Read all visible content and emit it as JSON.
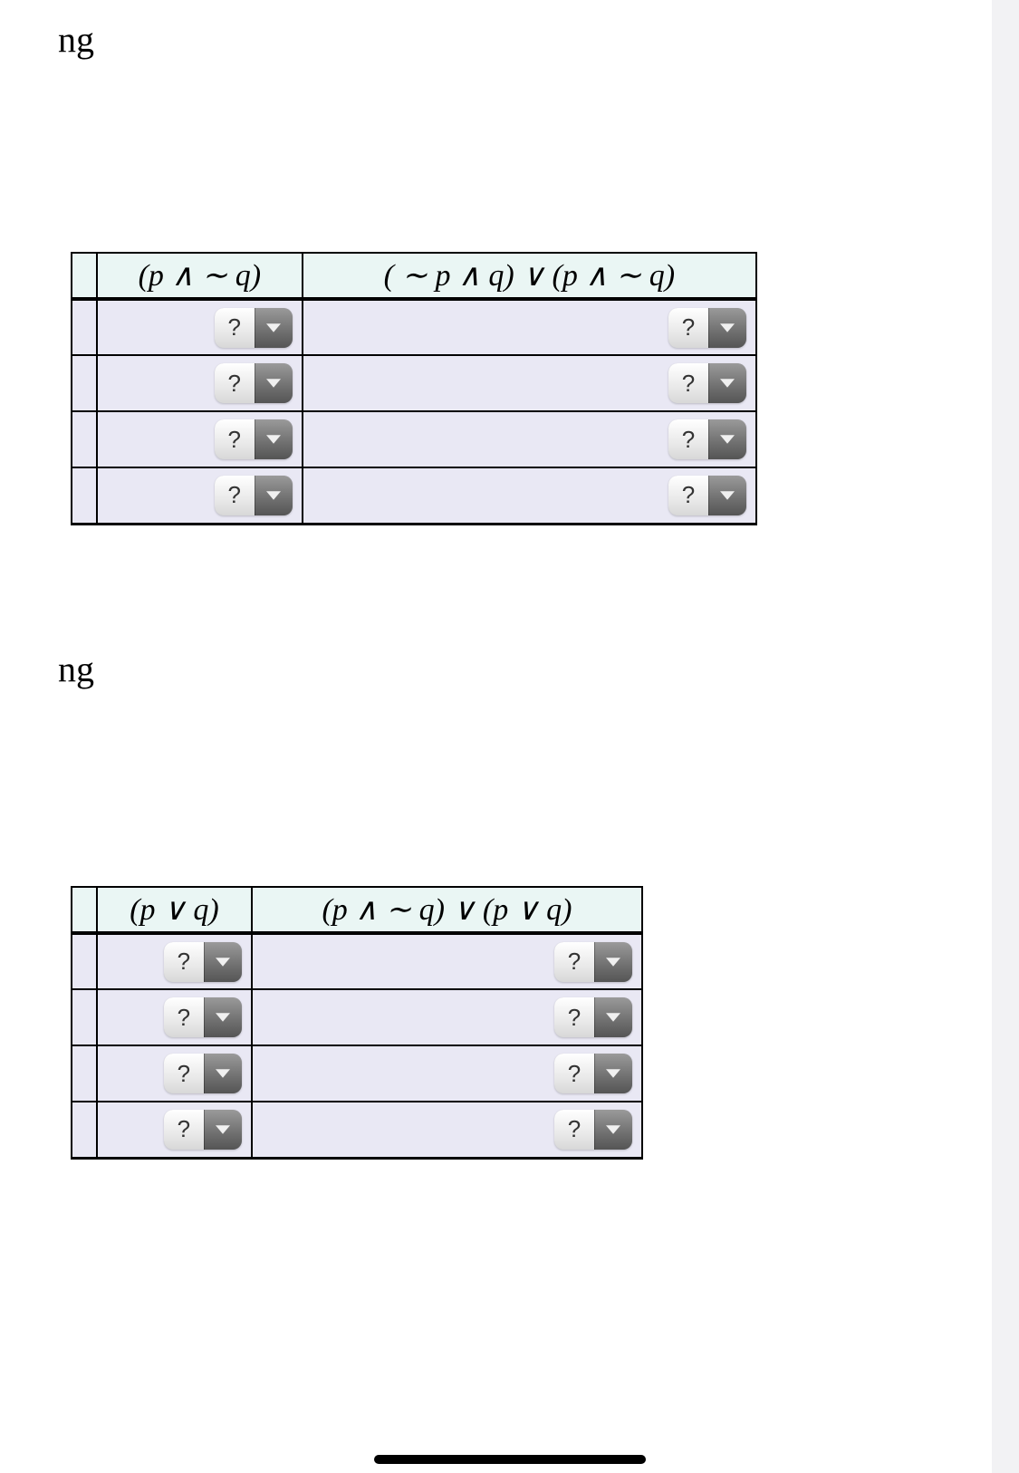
{
  "fragments": {
    "label1": "ng",
    "label2": "ng"
  },
  "dropdown": {
    "placeholder": "?"
  },
  "table1": {
    "headers": {
      "col1": "(p ∧ ∼ q)",
      "col2": "( ∼ p ∧ q) ∨ (p ∧ ∼ q)"
    },
    "rows": [
      {
        "c1": "?",
        "c2": "?"
      },
      {
        "c1": "?",
        "c2": "?"
      },
      {
        "c1": "?",
        "c2": "?"
      },
      {
        "c1": "?",
        "c2": "?"
      }
    ]
  },
  "table2": {
    "headers": {
      "col1": "(p ∨ q)",
      "col2": "(p ∧ ∼ q) ∨ (p ∨ q)"
    },
    "rows": [
      {
        "c1": "?",
        "c2": "?"
      },
      {
        "c1": "?",
        "c2": "?"
      },
      {
        "c1": "?",
        "c2": "?"
      },
      {
        "c1": "?",
        "c2": "?"
      }
    ]
  }
}
